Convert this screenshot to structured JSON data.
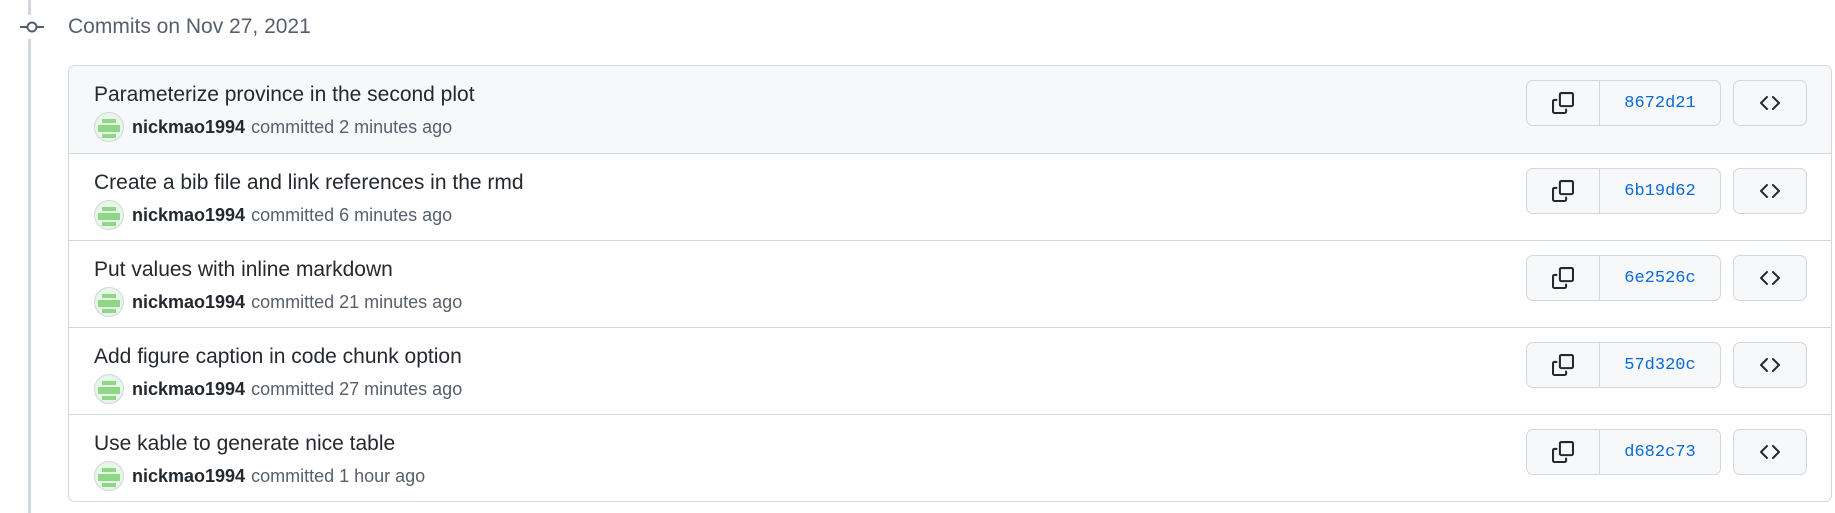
{
  "timeline": {
    "header_title": "Commits on Nov 27, 2021",
    "node_icon": "git-commit-icon"
  },
  "commits": [
    {
      "title": "Parameterize province in the second plot",
      "author": "nickmao1994",
      "action": "committed",
      "time": "2 minutes ago",
      "sha": "8672d21"
    },
    {
      "title": "Create a bib file and link references in the rmd",
      "author": "nickmao1994",
      "action": "committed",
      "time": "6 minutes ago",
      "sha": "6b19d62"
    },
    {
      "title": "Put values with inline markdown",
      "author": "nickmao1994",
      "action": "committed",
      "time": "21 minutes ago",
      "sha": "6e2526c"
    },
    {
      "title": "Add figure caption in code chunk option",
      "author": "nickmao1994",
      "action": "committed",
      "time": "27 minutes ago",
      "sha": "57d320c"
    },
    {
      "title": "Use kable to generate nice table",
      "author": "nickmao1994",
      "action": "committed",
      "time": "1 hour ago",
      "sha": "d682c73"
    }
  ],
  "icons": {
    "copy": "copy-icon",
    "browse": "code-icon",
    "avatar": "identicon-avatar"
  },
  "colors": {
    "link": "#0969da",
    "border": "#d0d7de",
    "muted": "#57606a",
    "avatar": "#8fd787"
  }
}
